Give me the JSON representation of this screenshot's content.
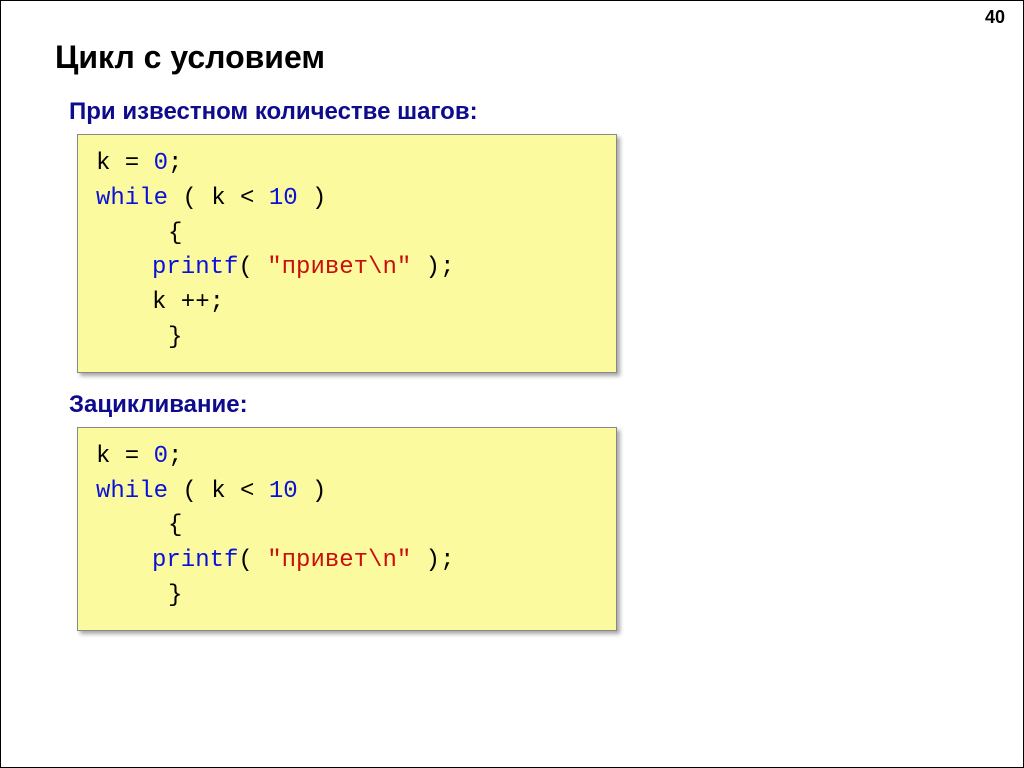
{
  "page_number": "40",
  "title": "Цикл с условием",
  "section1": {
    "heading": "При известном количестве шагов:",
    "code": {
      "l1a": "k = ",
      "l1b": "0",
      "l1c": ";",
      "l2a": "while",
      "l2b": " ( k < ",
      "l2c": "10",
      "l2d": " )",
      "l3": "{",
      "l4a": "printf",
      "l4b": "( ",
      "l4c": "\"привет\\n\"",
      "l4d": " );",
      "l5": "k ++;",
      "l6": "}"
    }
  },
  "section2": {
    "heading": "Зацикливание:",
    "code": {
      "l1a": "k = ",
      "l1b": "0",
      "l1c": ";",
      "l2a": "while",
      "l2b": " ( k < ",
      "l2c": "10",
      "l2d": " )",
      "l3": "{",
      "l4a": "printf",
      "l4b": "( ",
      "l4c": "\"привет\\n\"",
      "l4d": " );",
      "l5": "}"
    }
  }
}
